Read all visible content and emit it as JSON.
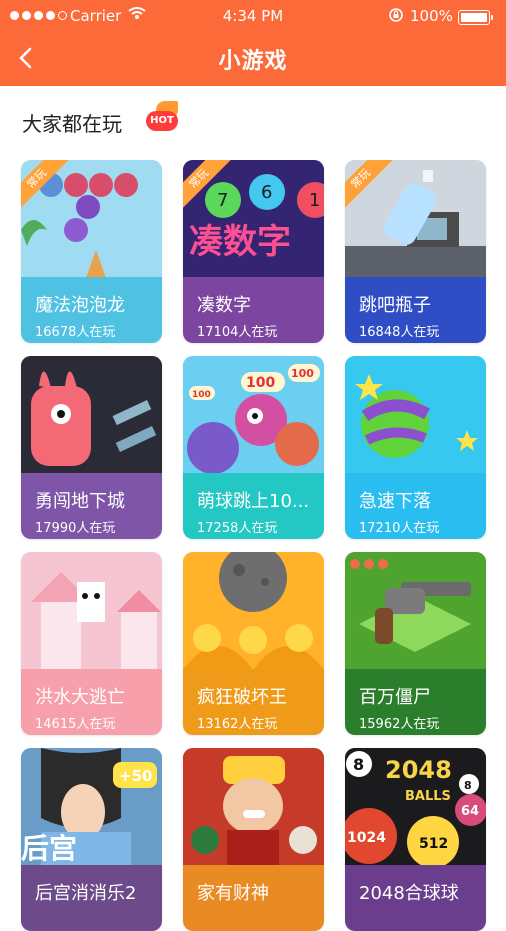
{
  "status_bar": {
    "carrier": "Carrier",
    "time": "4:34 PM",
    "battery": "100%"
  },
  "nav": {
    "title": "小游戏"
  },
  "section": {
    "title": "大家都在玩",
    "hot_badge": "HOT"
  },
  "cards": [
    {
      "name": "魔法泡泡龙",
      "count": "16678人在玩",
      "ribbon": "常玩",
      "color": "#4fc2e4",
      "icon": "bubble-shooter-icon",
      "art": "#a7ddf0"
    },
    {
      "name": "凑数字",
      "count": "17104人在玩",
      "ribbon": "常玩",
      "color": "#7b45a0",
      "icon": "number-game-icon",
      "art": "#3a2a7a",
      "art_text": "凑数字",
      "art_numbers": [
        "7",
        "6",
        "1"
      ]
    },
    {
      "name": "跳吧瓶子",
      "count": "16848人在玩",
      "ribbon": "常玩",
      "color": "#2f4ec6",
      "icon": "bottle-flip-icon",
      "art": "#cfd7e0"
    },
    {
      "name": "勇闯地下城",
      "count": "17990人在玩",
      "color": "#7f56a7",
      "icon": "dungeon-rabbit-icon",
      "art": "#2b2a3a"
    },
    {
      "name": "萌球跳上10...",
      "count": "17258人在玩",
      "color": "#23c7c4",
      "icon": "bouncing-balls-icon",
      "art": "#76d1f0",
      "art_numbers": [
        "100",
        "100",
        "100"
      ]
    },
    {
      "name": "急速下落",
      "count": "17210人在玩",
      "color": "#2abdf0",
      "icon": "falling-ball-icon",
      "art": "#47d3f0"
    },
    {
      "name": "洪水大逃亡",
      "count": "14615人在玩",
      "color": "#f7a0ab",
      "icon": "flood-escape-icon",
      "art": "#f7c7d2"
    },
    {
      "name": "疯狂破坏王",
      "count": "13162人在玩",
      "color": "#f09a1a",
      "icon": "destroyer-icon",
      "art": "#ffb32c"
    },
    {
      "name": "百万僵尸",
      "count": "15962人在玩",
      "color": "#2b7f2c",
      "icon": "zombie-gun-icon",
      "art": "#56ad32"
    },
    {
      "name": "后宫消消乐2",
      "count": "",
      "color": "#6d4b8a",
      "icon": "palace-match-icon",
      "art": "#6a9cc8",
      "art_text": "后宫",
      "art_badge": "+50"
    },
    {
      "name": "家有财神",
      "count": "",
      "color": "#e98a23",
      "icon": "fortune-god-icon",
      "art": "#c93a2a"
    },
    {
      "name": "2048合球球",
      "count": "",
      "color": "#6b3d8d",
      "icon": "ball-2048-icon",
      "art": "#1d1d1f",
      "art_text": "2048",
      "art_sub": "BALLS",
      "art_numbers": [
        "8",
        "64",
        "1024",
        "512",
        "8"
      ]
    }
  ],
  "colors": {
    "brand": "#fd6a39"
  }
}
